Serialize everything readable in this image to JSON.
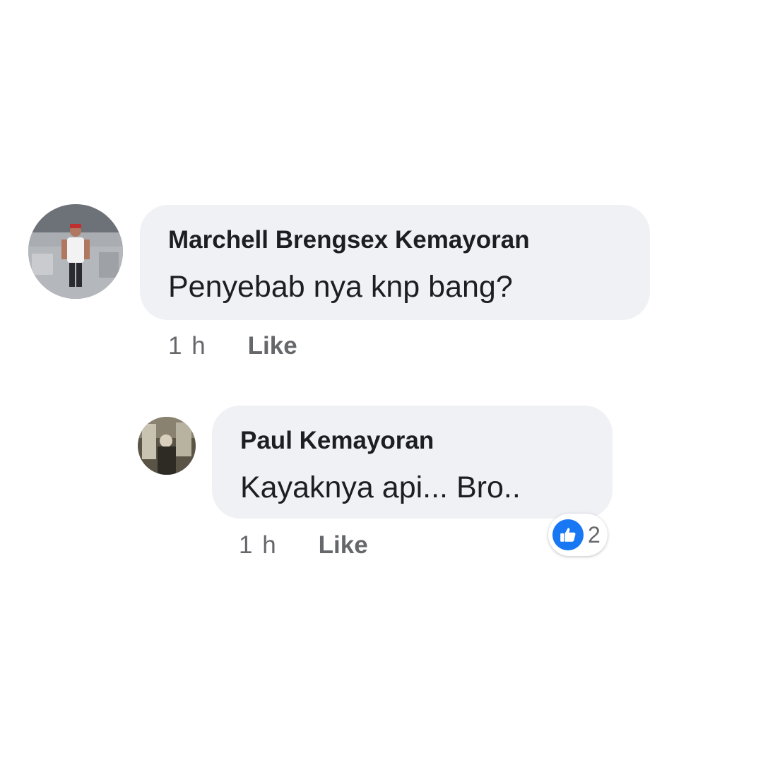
{
  "comments": [
    {
      "author": "Marchell Brengsex Kemayoran",
      "text": "Penyebab nya knp bang?",
      "time": "1 h",
      "like_label": "Like"
    },
    {
      "author": "Paul Kemayoran",
      "text": "Kayaknya api... Bro..",
      "time": "1 h",
      "like_label": "Like",
      "reaction_icon": "thumbs-up-icon",
      "reaction_count": "2"
    }
  ],
  "colors": {
    "bubble": "#f0f1f5",
    "meta_text": "#65676b",
    "like_blue": "#1877f2"
  }
}
